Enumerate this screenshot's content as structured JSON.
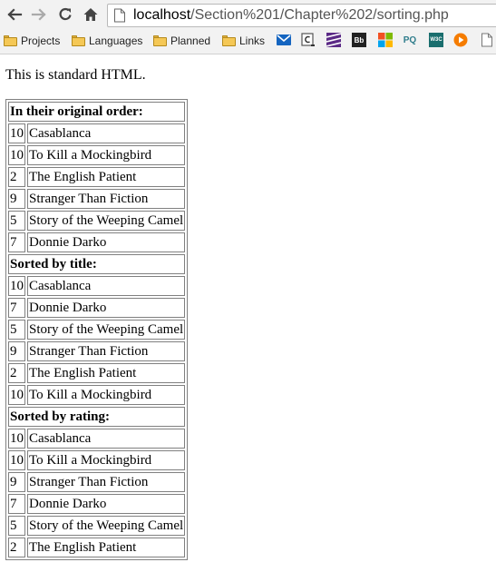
{
  "browser": {
    "url_host": "localhost",
    "url_path": "/Section%201/Chapter%202/sorting.php",
    "bookmarks": [
      "Projects",
      "Languages",
      "Planned",
      "Links"
    ],
    "favicons": [
      {
        "name": "mail-icon",
        "color": "#1565c0"
      },
      {
        "name": "c-bookmark-icon",
        "color": "#555555"
      },
      {
        "name": "stripes-icon",
        "color": "#5b2a86"
      },
      {
        "name": "bb-icon",
        "color": "#222222"
      },
      {
        "name": "windows-icon",
        "color": "#f25022"
      },
      {
        "name": "pq-icon",
        "color": "#2f7d8c"
      },
      {
        "name": "w3c-icon",
        "color": "#1a6e6e"
      },
      {
        "name": "play-icon",
        "color": "#f57c00"
      },
      {
        "name": "page-icon",
        "color": "#777777"
      }
    ],
    "favicon_labels": {
      "bb": "Bb",
      "pq": "PQ",
      "w3c": "W3C"
    }
  },
  "page": {
    "intro": "This is standard HTML."
  },
  "sections": [
    {
      "heading": "In their original order:",
      "rows": [
        {
          "rating": "10",
          "title": "Casablanca"
        },
        {
          "rating": "10",
          "title": "To Kill a Mockingbird"
        },
        {
          "rating": "2",
          "title": "The English Patient"
        },
        {
          "rating": "9",
          "title": "Stranger Than Fiction"
        },
        {
          "rating": "5",
          "title": "Story of the Weeping Camel"
        },
        {
          "rating": "7",
          "title": "Donnie Darko"
        }
      ]
    },
    {
      "heading": "Sorted by title:",
      "rows": [
        {
          "rating": "10",
          "title": "Casablanca"
        },
        {
          "rating": "7",
          "title": "Donnie Darko"
        },
        {
          "rating": "5",
          "title": "Story of the Weeping Camel"
        },
        {
          "rating": "9",
          "title": "Stranger Than Fiction"
        },
        {
          "rating": "2",
          "title": "The English Patient"
        },
        {
          "rating": "10",
          "title": "To Kill a Mockingbird"
        }
      ]
    },
    {
      "heading": "Sorted by rating:",
      "rows": [
        {
          "rating": "10",
          "title": "Casablanca"
        },
        {
          "rating": "10",
          "title": "To Kill a Mockingbird"
        },
        {
          "rating": "9",
          "title": "Stranger Than Fiction"
        },
        {
          "rating": "7",
          "title": "Donnie Darko"
        },
        {
          "rating": "5",
          "title": "Story of the Weeping Camel"
        },
        {
          "rating": "2",
          "title": "The English Patient"
        }
      ]
    }
  ]
}
